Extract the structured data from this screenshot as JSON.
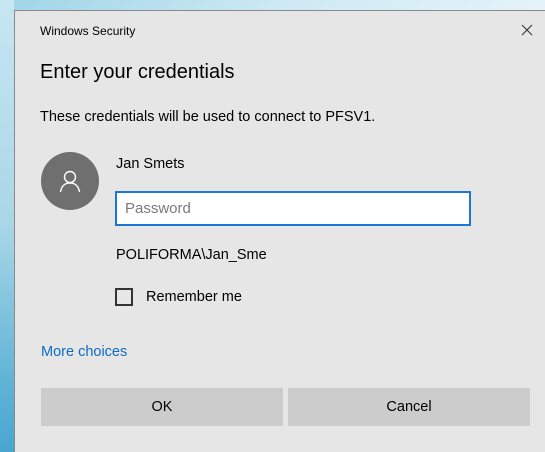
{
  "window": {
    "title": "Windows Security"
  },
  "dialog": {
    "heading": "Enter your credentials",
    "message": "These credentials will be used to connect to PFSV1."
  },
  "account": {
    "display_name": "Jan Smets",
    "domain_user": "POLIFORMA\\Jan_Sme",
    "avatar_icon": "person-icon"
  },
  "password": {
    "placeholder": "Password",
    "value": ""
  },
  "remember": {
    "label": "Remember me",
    "checked": false
  },
  "links": {
    "more_choices": "More choices"
  },
  "buttons": {
    "ok": "OK",
    "cancel": "Cancel"
  },
  "colors": {
    "accent": "#1a78d6",
    "link": "#0e6cc6",
    "dialog_bg": "#e6e6e6",
    "button_bg": "#cccccc",
    "avatar_bg": "#6f6f6f"
  }
}
